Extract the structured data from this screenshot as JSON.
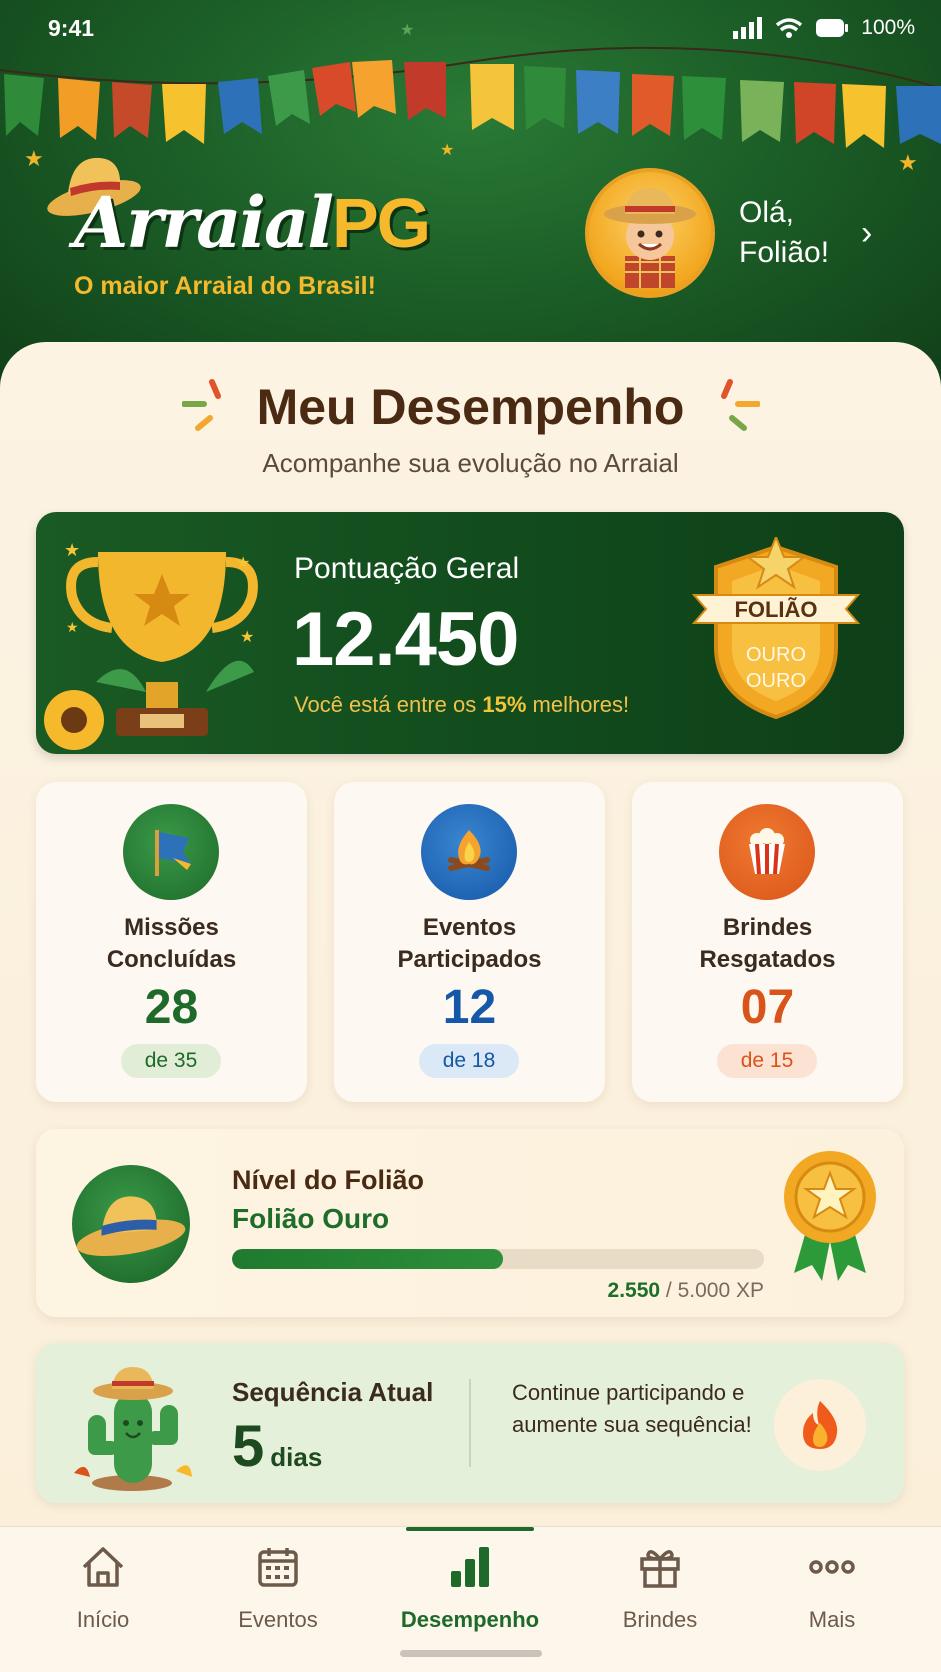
{
  "status_bar": {
    "time": "9:41",
    "battery": "100%"
  },
  "header": {
    "logo_part1": "Arraial",
    "logo_part2": "PG",
    "tagline": "O maior Arraial do Brasil!",
    "greeting_line1": "Olá,",
    "greeting_line2": "Folião!"
  },
  "section": {
    "title": "Meu Desempenho",
    "subtitle": "Acompanhe sua evolução no Arraial"
  },
  "score": {
    "label": "Pontuação Geral",
    "value": "12.450",
    "note_prefix": "Você está entre os ",
    "note_highlight": "15%",
    "note_suffix": " melhores!",
    "badge_title": "FOLIÃO",
    "badge_line1": "OURO",
    "badge_line2": "OURO"
  },
  "stats": [
    {
      "label_line1": "Missões",
      "label_line2": "Concluídas",
      "value": "28",
      "total": "de 35",
      "color": "#1d6a2a",
      "pill_bg": "#e1edd6",
      "icon": "flag-icon"
    },
    {
      "label_line1": "Eventos",
      "label_line2": "Participados",
      "value": "12",
      "total": "de 18",
      "color": "#1557a8",
      "pill_bg": "#dbe8f6",
      "icon": "bonfire-icon"
    },
    {
      "label_line1": "Brindes",
      "label_line2": "Resgatados",
      "value": "07",
      "total": "de 15",
      "color": "#d9541a",
      "pill_bg": "#fbe2d2",
      "icon": "popcorn-icon"
    }
  ],
  "level": {
    "title": "Nível do Folião",
    "name": "Folião Ouro",
    "xp_current": "2.550",
    "xp_total": " / 5.000 XP",
    "progress": 0.51
  },
  "streak": {
    "title": "Sequência Atual",
    "value": "5",
    "unit": "dias",
    "message": "Continue participando e aumente sua sequência!"
  },
  "nav": {
    "items": [
      {
        "label": "Início",
        "icon": "home-icon",
        "active": false
      },
      {
        "label": "Eventos",
        "icon": "calendar-icon",
        "active": false
      },
      {
        "label": "Desempenho",
        "icon": "bar-chart-icon",
        "active": true
      },
      {
        "label": "Brindes",
        "icon": "gift-icon",
        "active": false
      },
      {
        "label": "Mais",
        "icon": "more-icon",
        "active": false
      }
    ]
  },
  "colors": {
    "brand_green": "#1d6a2a",
    "gold": "#f6b92b",
    "cream": "#fcf3e3"
  }
}
